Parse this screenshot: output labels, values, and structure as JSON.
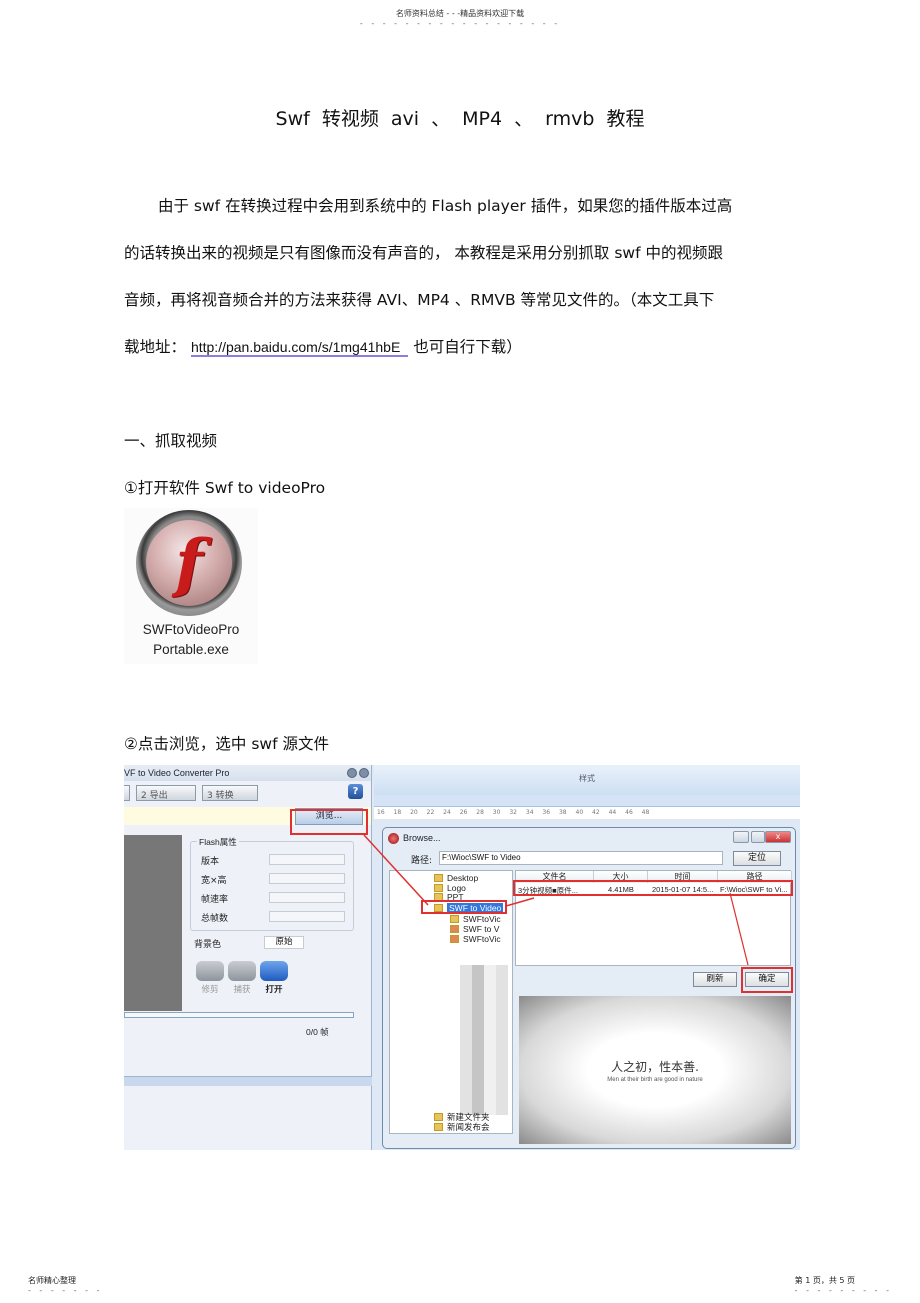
{
  "header": {
    "text": "名师资料总结 - - -精品资料欢迎下载",
    "dots": "- - - - - - - - - - - - - - - - - -"
  },
  "title": "Swf 转视频 avi 、 MP4 、 rmvb 教程",
  "intro": {
    "line1": "由于 swf 在转换过程中会用到系统中的 Flash player 插件，如果您的插件版本过高",
    "line2": "的话转换出来的视频是只有图像而没有声音的， 本教程是采用分别抓取 swf 中的视频跟",
    "line3": "音频，再将视音频合并的方法来获得 AVI、MP4 、RMVB 等常见文件的。（本文工具下",
    "line4_prefix": "载地址：",
    "link": "http://pan.baidu.com/s/1mg41hbE",
    "line4_suffix": "也可自行下载）"
  },
  "section1": {
    "heading": "一、抓取视频",
    "step1": "①打开软件 Swf to videoPro",
    "app_icon": {
      "icon": "flash-icon",
      "label_line1": "SWFtoVideoPro",
      "label_line2": "Portable.exe"
    },
    "step2": "②点击浏览，选中 swf 源文件"
  },
  "screenshot": {
    "app": {
      "title": "VF to Video Converter Pro",
      "toolbar": [
        "2 导出",
        "3 转换"
      ],
      "help": "?",
      "browse_button": "浏览...",
      "flash_props": {
        "title": "Flash属性",
        "fields": [
          "版本",
          "宽×高",
          "帧速率",
          "总帧数"
        ]
      },
      "bg_label": "背景色",
      "bg_value": "原始",
      "actions": [
        "修剪",
        "捕获",
        "打开"
      ],
      "frames": "0/0 帧"
    },
    "ribbon": {
      "label": "样式",
      "ruler": "16 18 20 22 24 26 28 30 32 34 36 38 40 42 44 46 48"
    },
    "dialog": {
      "title": "Browse...",
      "path_label": "路径:",
      "path_value": "F:\\Wioc\\SWF to Video",
      "locate_button": "定位",
      "tree": [
        "Desktop",
        "Logo",
        "PPT",
        "SWF to Video",
        "SWFtoVic",
        "SWF to V",
        "SWFtoVic",
        "新建文件夹",
        "新闻发布会"
      ],
      "columns": [
        "文件名",
        "大小",
        "时间",
        "路径"
      ],
      "rows": [
        [
          "3分钟视频■原件...",
          "4.41MB",
          "2015-01-07 14:5...",
          "F:\\Wioc\\SWF to Vi..."
        ]
      ],
      "refresh_button": "刷新",
      "ok_button": "确定",
      "preview_main": "人之初，性本善.",
      "preview_sub": "Men at their birth are good in nature"
    }
  },
  "footer": {
    "left": "名师精心整理",
    "left_dots": "- - - - - - -",
    "right": "第 1 页，共 5 页",
    "right_dots": "- - - - - - - - -"
  }
}
